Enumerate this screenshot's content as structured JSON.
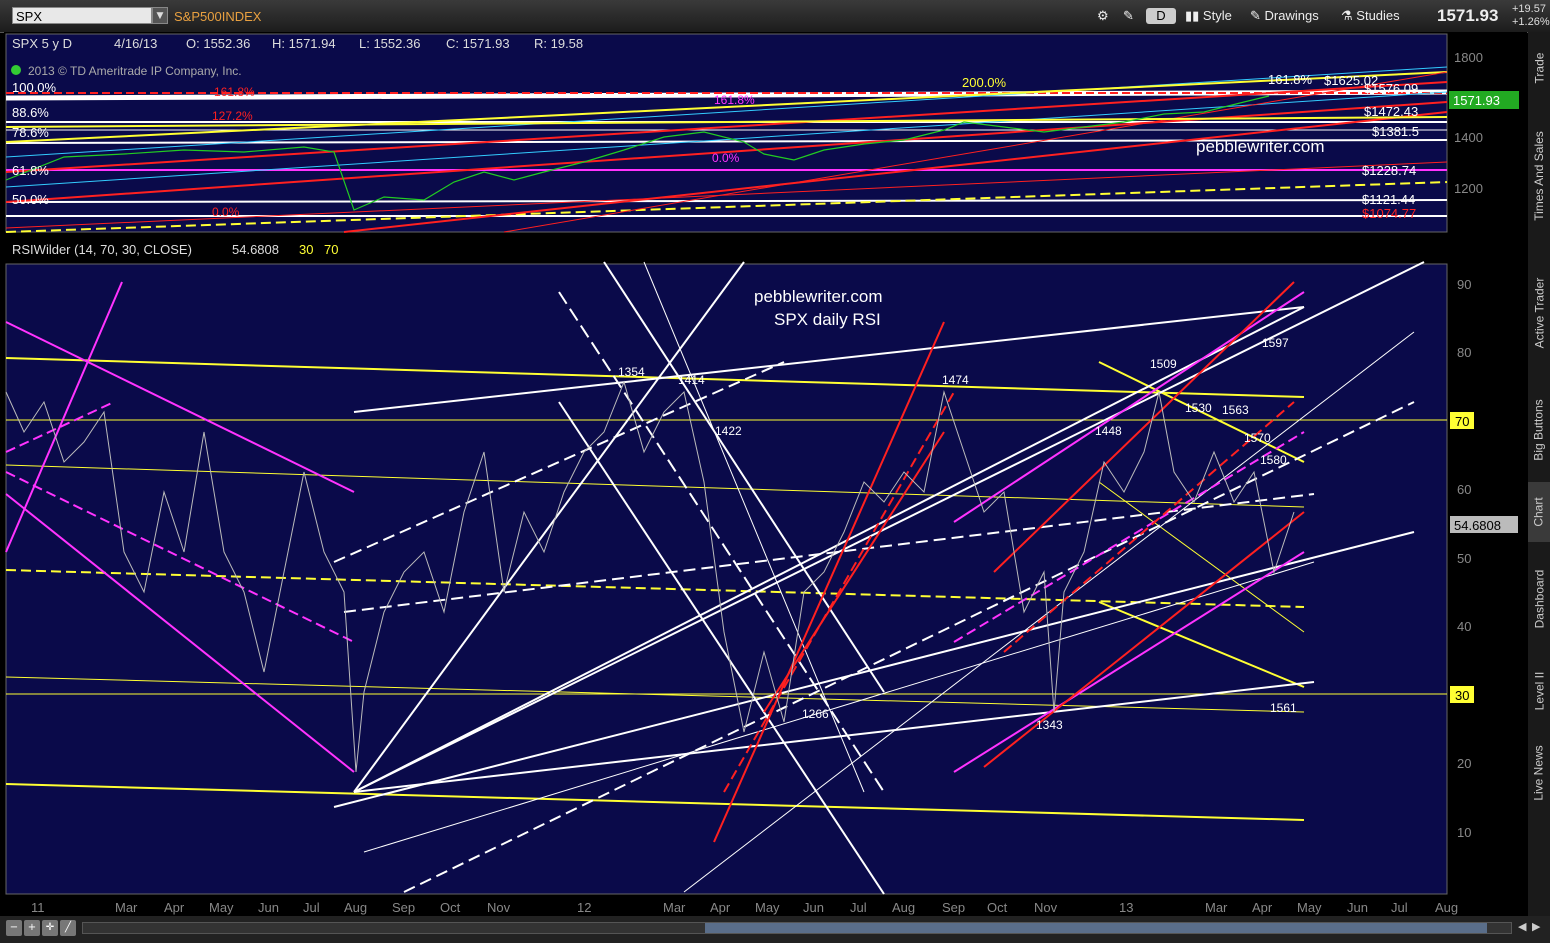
{
  "toolbar": {
    "symbol": "SPX",
    "description": "S&P500INDEX",
    "mode_btn": "D",
    "style_btn": "Style",
    "drawings_btn": "Drawings",
    "studies_btn": "Studies",
    "last_price": "1571.93",
    "change_abs": "+19.57",
    "change_pct": "+1.26%"
  },
  "upper_panel": {
    "info": {
      "symbol": "SPX 5 y D",
      "date": "4/16/13",
      "open": "O: 1552.36",
      "high": "H: 1571.94",
      "low": "L: 1552.36",
      "close": "C: 1571.93",
      "range": "R: 19.58"
    },
    "copyright": "2013 © TD Ameritrade IP Company, Inc.",
    "fib_left": [
      "100.0%",
      "88.6%",
      "78.6%",
      "61.8%",
      "50.0%"
    ],
    "fib_mid": [
      "161.8%",
      "127.2%",
      "0.0%",
      "200.0%",
      "161.8%",
      "0.0%"
    ],
    "price_labels": [
      "$1625.02",
      "$1576.09",
      "$1472.43",
      "$1381.5",
      "$1228.74",
      "$1121.44",
      "$1074.77"
    ],
    "axis": [
      "1800",
      "1400",
      "1200"
    ],
    "price_badge": "1571.93",
    "watermark": "pebblewriter.com",
    "fib_top_right": "161.8%"
  },
  "rsi_panel": {
    "study_label": "RSIWilder (14, 70, 30, CLOSE)",
    "value": "54.6808",
    "ob": "30",
    "os": "70",
    "title1": "pebblewriter.com",
    "title2": "SPX daily RSI",
    "axis": [
      "90",
      "80",
      "70",
      "60",
      "50",
      "40",
      "30",
      "20",
      "10"
    ],
    "badge_70": "70",
    "badge_30": "30",
    "badge_value": "54.6808",
    "annotations": [
      {
        "text": "1354"
      },
      {
        "text": "1414"
      },
      {
        "text": "1422"
      },
      {
        "text": "1474"
      },
      {
        "text": "1509"
      },
      {
        "text": "1597"
      },
      {
        "text": "1448"
      },
      {
        "text": "1530"
      },
      {
        "text": "1563"
      },
      {
        "text": "1570"
      },
      {
        "text": "1580"
      },
      {
        "text": "1266"
      },
      {
        "text": "1343"
      },
      {
        "text": "1561"
      }
    ]
  },
  "x_axis": [
    "11",
    "Mar",
    "Apr",
    "May",
    "Jun",
    "Jul",
    "Aug",
    "Sep",
    "Oct",
    "Nov",
    "12",
    "Mar",
    "Apr",
    "May",
    "Jun",
    "Jul",
    "Aug",
    "Sep",
    "Oct",
    "Nov",
    "13",
    "Mar",
    "Apr",
    "May",
    "Jun",
    "Jul",
    "Aug"
  ],
  "sidebar": [
    "Trade",
    "Times And Sales",
    "Active Trader",
    "Big Buttons",
    "Chart",
    "Dashboard",
    "Level II",
    "Live News"
  ],
  "colors": {
    "panel_bg": "#0a0a4a",
    "yellow": "#ffff33",
    "magenta": "#ff33ff",
    "red": "#ff2020",
    "white": "#ffffff",
    "cyan": "#33ccff"
  }
}
